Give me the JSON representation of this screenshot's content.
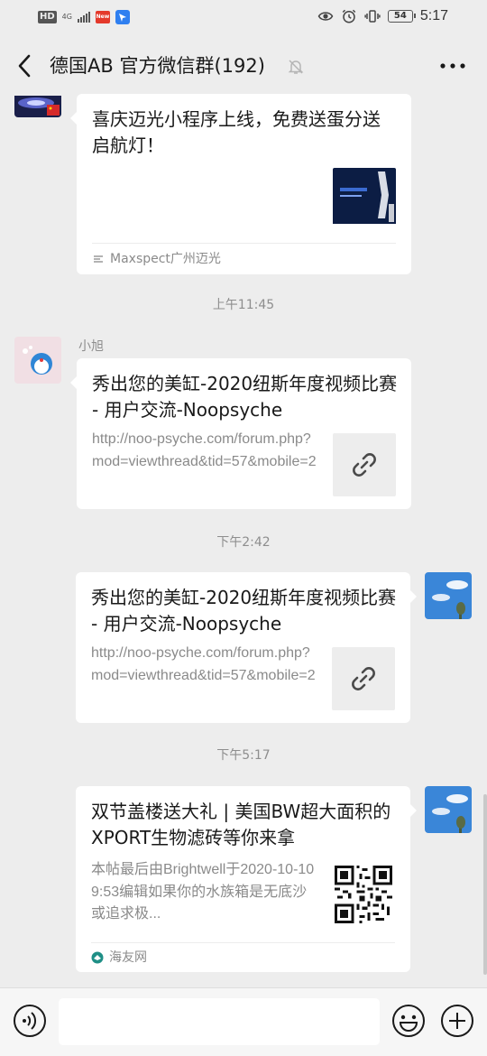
{
  "status_bar": {
    "hd": "HD",
    "net": "4G",
    "battery": "54",
    "time": "5:17"
  },
  "header": {
    "title": "德国AB  官方微信群(192)",
    "icons": [
      "back-arrow-icon",
      "mute-bell-icon",
      "more-dots-icon"
    ]
  },
  "messages": [
    {
      "side": "left",
      "title": "喜庆迈光小程序上线，免费送蛋分送启航灯！",
      "source": "Maxspect广州迈光",
      "thumb": "image"
    },
    {
      "timestamp": "上午11:45"
    },
    {
      "side": "left",
      "sender": "小旭",
      "title": "秀出您的美缸-2020纽斯年度视频比赛 - 用户交流-Noopsyche",
      "desc": "http://noo-psyche.com/forum.php?mod=viewthread&tid=57&mobile=2",
      "thumb": "link-icon"
    },
    {
      "timestamp": "下午2:42"
    },
    {
      "side": "right",
      "title": "秀出您的美缸-2020纽斯年度视频比赛 - 用户交流-Noopsyche",
      "desc": "http://noo-psyche.com/forum.php?mod=viewthread&tid=57&mobile=2",
      "thumb": "link-icon"
    },
    {
      "timestamp": "下午5:17"
    },
    {
      "side": "right",
      "title": "双节盖楼送大礼 | 美国BW超大面积的XPORT生物滤砖等你来拿",
      "desc": "本帖最后由Brightwell于2020-10-109:53编辑如果你的水族箱是无底沙或追求极...",
      "source": "海友网",
      "thumb": "qr-code"
    }
  ],
  "input_bar": {
    "icons": [
      "voice-icon",
      "emoji-icon",
      "plus-icon"
    ],
    "value": ""
  },
  "colors": {
    "background": "#ededed",
    "bubble": "#ffffff",
    "text": "#191919",
    "muted": "#8a8a8a"
  }
}
